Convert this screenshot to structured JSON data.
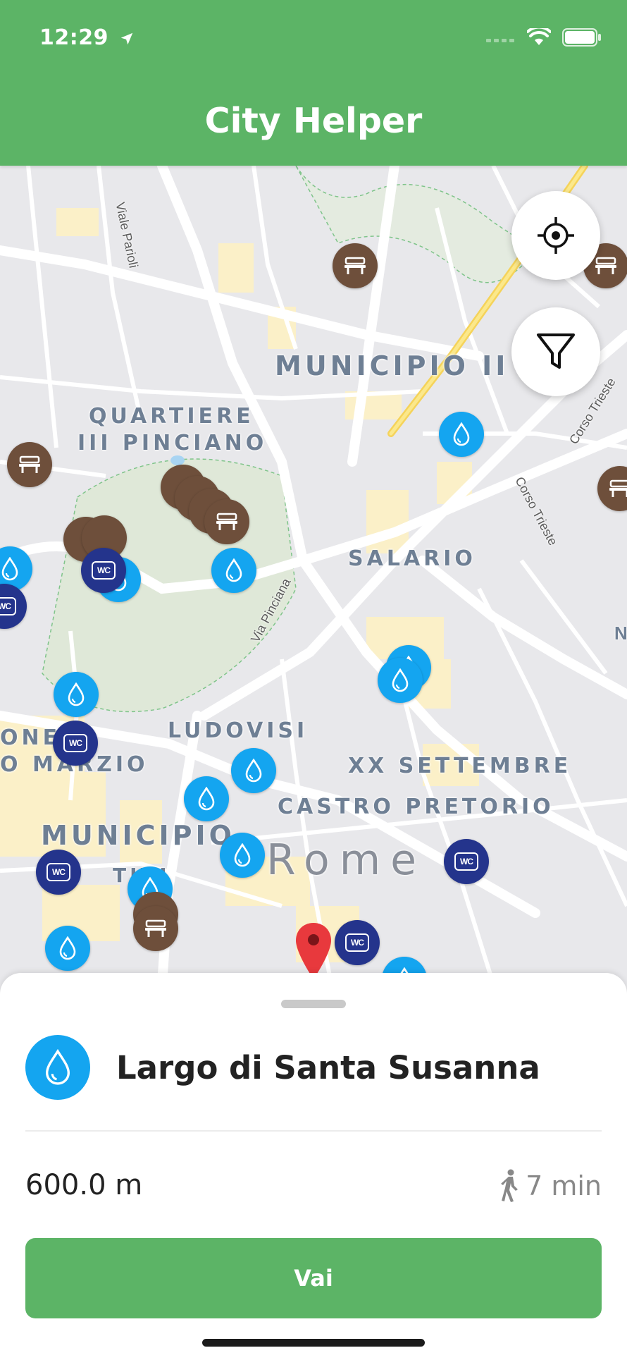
{
  "status_bar": {
    "time": "12:29"
  },
  "header": {
    "title": "City Helper"
  },
  "map": {
    "area_labels": [
      "MUNICIPIO II",
      "QUARTIERE",
      "III PINCIANO",
      "SALARIO",
      "LUDOVISI",
      "XX SETTEMBRE",
      "CASTRO PRETORIO",
      "ONE",
      "O MARZIO",
      "MUNICIPIO",
      "TIVI",
      "Rome"
    ],
    "street_labels": [
      "Viale Parioli",
      "Via Pinciana",
      "Corso Trieste",
      "Corso Trieste",
      "N"
    ],
    "marker_types": [
      "fountain",
      "bench",
      "wc"
    ],
    "wc_label": "WC"
  },
  "sheet": {
    "place_name": "Largo di Santa Susanna",
    "place_icon": "water-drop-icon",
    "distance": "600.0 m",
    "duration": "7 min",
    "go_label": "Vai"
  },
  "colors": {
    "primary": "#5cb466",
    "fountain": "#14a5f0",
    "bench": "#6e4f3b",
    "wc": "#24348c",
    "pin": "#e8393d",
    "user_location": "#3f7dec"
  }
}
